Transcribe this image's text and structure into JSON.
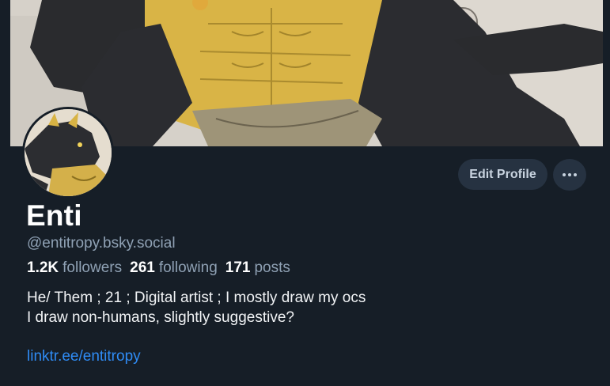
{
  "profile": {
    "display_name": "Enti",
    "handle": "@entitropy.bsky.social",
    "stats": {
      "followers_count": "1.2K",
      "followers_label": "followers",
      "following_count": "261",
      "following_label": "following",
      "posts_count": "171",
      "posts_label": "posts"
    },
    "bio_lines": [
      "He/ Them ; 21 ; Digital artist ; I mostly draw my ocs",
      "I draw non-humans, slightly suggestive?"
    ],
    "link": "linktr.ee/entitropy"
  },
  "actions": {
    "edit_profile_label": "Edit Profile",
    "more_icon": "ellipsis-icon"
  },
  "colors": {
    "background": "#161e27",
    "button_bg": "#263241",
    "link": "#2f8cf5",
    "muted_text": "#8fa1b4"
  }
}
